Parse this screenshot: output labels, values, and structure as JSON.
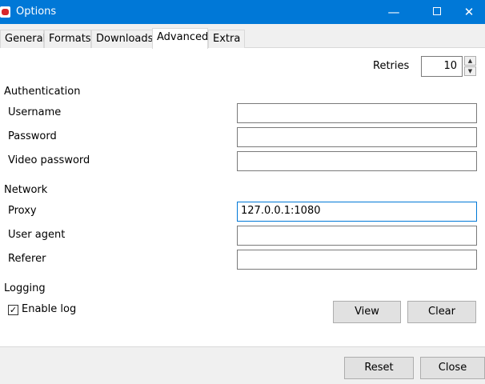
{
  "window": {
    "title": "Options",
    "minimize_glyph": "—",
    "close_glyph": "✕"
  },
  "tabs": [
    {
      "label": "General"
    },
    {
      "label": "Formats"
    },
    {
      "label": "Downloads"
    },
    {
      "label": "Advanced",
      "selected": true
    },
    {
      "label": "Extra"
    }
  ],
  "retries": {
    "label": "Retries",
    "value": "10",
    "up_glyph": "▲",
    "down_glyph": "▼"
  },
  "authentication": {
    "title": "Authentication",
    "username": {
      "label": "Username",
      "value": ""
    },
    "password": {
      "label": "Password",
      "value": ""
    },
    "video_password": {
      "label": "Video password",
      "value": ""
    }
  },
  "network": {
    "title": "Network",
    "proxy": {
      "label": "Proxy",
      "value": "127.0.0.1:1080"
    },
    "user_agent": {
      "label": "User agent",
      "value": ""
    },
    "referer": {
      "label": "Referer",
      "value": ""
    }
  },
  "logging": {
    "title": "Logging",
    "enable_log": {
      "label": "Enable log",
      "checked": true,
      "check_glyph": "✓"
    },
    "view_label": "View",
    "clear_label": "Clear"
  },
  "footer": {
    "reset_label": "Reset",
    "close_label": "Close"
  },
  "colors": {
    "titlebar": "#0078d7",
    "focus_border": "#0078d7",
    "panel": "#f0f0f0",
    "button": "#e1e1e1"
  }
}
